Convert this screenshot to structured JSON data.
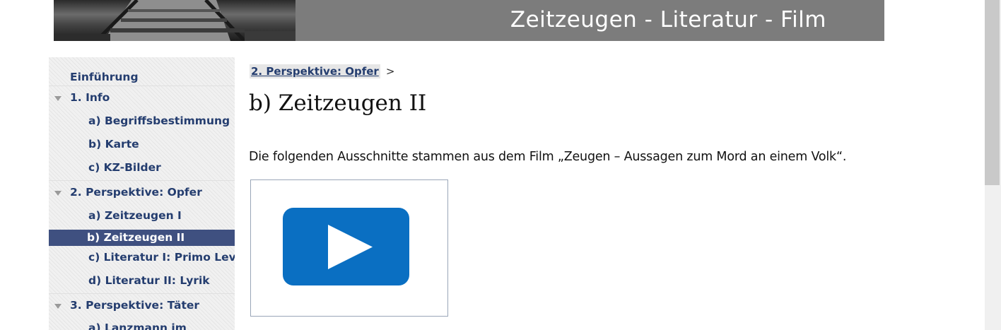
{
  "banner": {
    "title": "Zeitzeugen - Literatur - Film"
  },
  "sidebar": {
    "items": [
      {
        "label": "Einführung",
        "level": 0,
        "expandable": false
      },
      {
        "label": "1. Info",
        "level": 0,
        "expandable": true
      },
      {
        "label": "a) Begriffsbestimmung",
        "level": 1
      },
      {
        "label": "b) Karte",
        "level": 1
      },
      {
        "label": "c) KZ-Bilder",
        "level": 1
      },
      {
        "label": "2. Perspektive: Opfer",
        "level": 0,
        "expandable": true
      },
      {
        "label": "a) Zeitzeugen I",
        "level": 1
      },
      {
        "label": "b) Zeitzeugen II",
        "level": 1,
        "active": true
      },
      {
        "label": "c) Literatur I: Primo Levi",
        "level": 1
      },
      {
        "label": "d) Literatur II: Lyrik",
        "level": 1
      },
      {
        "label": "3. Perspektive: Täter",
        "level": 0,
        "expandable": true
      },
      {
        "label": "a) Lanzmann im",
        "level": 1
      }
    ]
  },
  "breadcrumb": {
    "link": "2. Perspektive: Opfer",
    "separator": ">"
  },
  "main": {
    "title": "b) Zeitzeugen II",
    "intro": "Die folgenden Ausschnitte stammen aus dem Film „Zeugen – Aussagen zum Mord an einem Volk“."
  },
  "video": {
    "icon": "play-icon",
    "button_color": "#0a6fc2"
  },
  "colors": {
    "nav_text": "#243d6f",
    "nav_active_bg": "#3f5080",
    "banner_bg": "#7c7c7c"
  }
}
